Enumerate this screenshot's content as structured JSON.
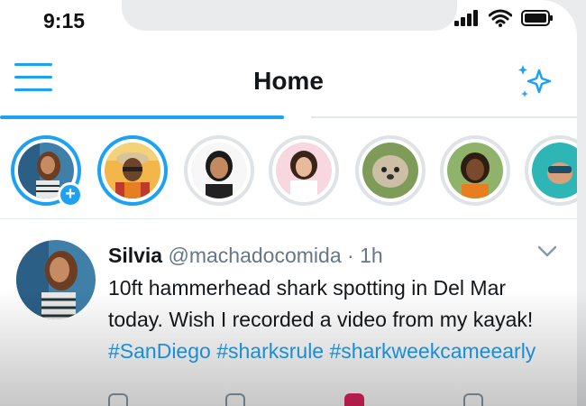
{
  "status_bar": {
    "time": "9:15"
  },
  "header": {
    "title": "Home",
    "menu_icon": "hamburger-menu-icon",
    "right_icon": "sparkle-icon"
  },
  "colors": {
    "accent": "#1da1f2",
    "text": "#14171a",
    "muted": "#657786",
    "like": "#e0245e"
  },
  "stories": [
    {
      "name": "your-story",
      "seen": false,
      "add": true
    },
    {
      "name": "story-2",
      "seen": false
    },
    {
      "name": "story-3",
      "seen": true
    },
    {
      "name": "story-4",
      "seen": true
    },
    {
      "name": "story-5",
      "seen": true
    },
    {
      "name": "story-6",
      "seen": true
    },
    {
      "name": "story-7",
      "seen": true
    }
  ],
  "tweet": {
    "name": "Silvia",
    "handle": "@machadocomida",
    "separator": "·",
    "time": "1h",
    "text_part1": "10ft hammerhead shark spotting in Del Mar today. Wish I recorded a video from my kayak! ",
    "hashtags": [
      "#SanDiego",
      "#sharksrule",
      "#sharkweekcameearly"
    ]
  }
}
